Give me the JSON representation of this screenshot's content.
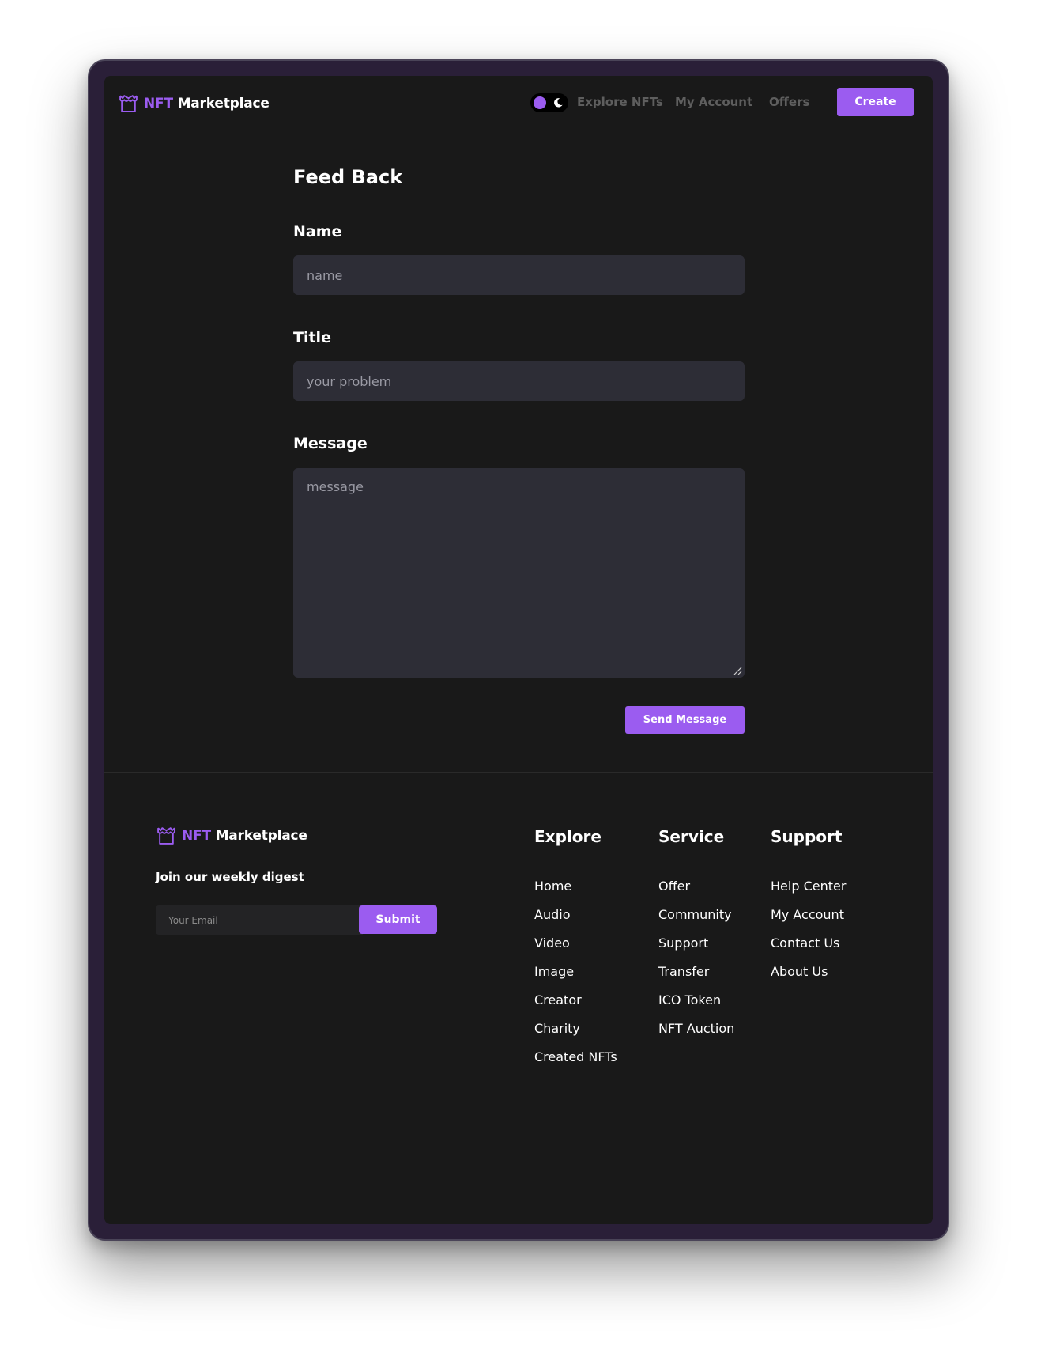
{
  "brand": {
    "nft": "NFT",
    "name": "Marketplace"
  },
  "nav": {
    "links": [
      "Explore NFTs",
      "My Account",
      "Offers"
    ],
    "create_label": "Create"
  },
  "form": {
    "title": "Feed Back",
    "name_label": "Name",
    "name_placeholder": "name",
    "title_label": "Title",
    "title_placeholder": "your problem",
    "message_label": "Message",
    "message_placeholder": "message",
    "send_label": "Send Message"
  },
  "footer": {
    "digest": "Join our weekly digest",
    "email_placeholder": "Your Email",
    "submit_label": "Submit",
    "columns": [
      {
        "title": "Explore",
        "items": [
          "Home",
          "Audio",
          "Video",
          "Image",
          "Creator",
          "Charity",
          "Created NFTs"
        ]
      },
      {
        "title": "Service",
        "items": [
          "Offer",
          "Community",
          "Support",
          "Transfer",
          "ICO Token",
          "NFT Auction"
        ]
      },
      {
        "title": "Support",
        "items": [
          "Help Center",
          "My Account",
          "Contact Us",
          "About Us"
        ]
      }
    ]
  },
  "colors": {
    "accent": "#9b5cf0",
    "background": "#191919",
    "input": "#2d2d36"
  }
}
